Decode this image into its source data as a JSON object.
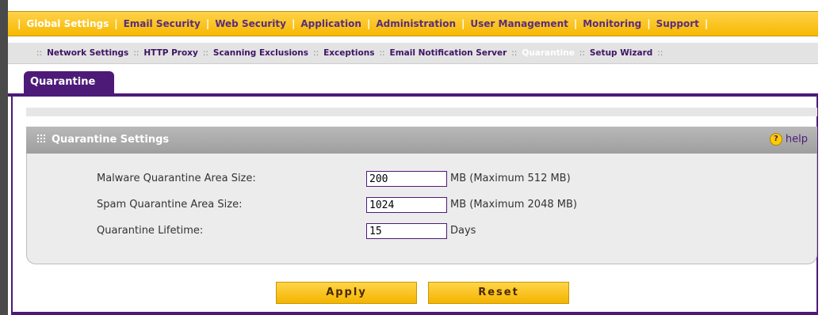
{
  "top_nav": {
    "items": [
      {
        "label": "Global Settings",
        "active": true
      },
      {
        "label": "Email Security",
        "active": false
      },
      {
        "label": "Web Security",
        "active": false
      },
      {
        "label": "Application",
        "active": false
      },
      {
        "label": "Administration",
        "active": false
      },
      {
        "label": "User Management",
        "active": false
      },
      {
        "label": "Monitoring",
        "active": false
      },
      {
        "label": "Support",
        "active": false
      }
    ]
  },
  "sub_nav": {
    "items": [
      {
        "label": "Network Settings",
        "active": false
      },
      {
        "label": "HTTP Proxy",
        "active": false
      },
      {
        "label": "Scanning Exclusions",
        "active": false
      },
      {
        "label": "Exceptions",
        "active": false
      },
      {
        "label": "Email Notification Server",
        "active": false
      },
      {
        "label": "Quarantine",
        "active": true
      },
      {
        "label": "Setup Wizard",
        "active": false
      }
    ]
  },
  "tab": {
    "label": "Quarantine"
  },
  "panel": {
    "title": "Quarantine Settings",
    "help_label": "help",
    "fields": [
      {
        "label": "Malware Quarantine Area Size:",
        "value": "200",
        "unit": "MB (Maximum 512 MB)"
      },
      {
        "label": "Spam Quarantine Area Size:",
        "value": "1024",
        "unit": "MB (Maximum 2048 MB)"
      },
      {
        "label": "Quarantine Lifetime:",
        "value": "15",
        "unit": "Days"
      }
    ]
  },
  "buttons": {
    "apply": "Apply",
    "reset": "Reset"
  },
  "colors": {
    "accent": "#4d1a78",
    "nav_gold": "#f6b800"
  }
}
